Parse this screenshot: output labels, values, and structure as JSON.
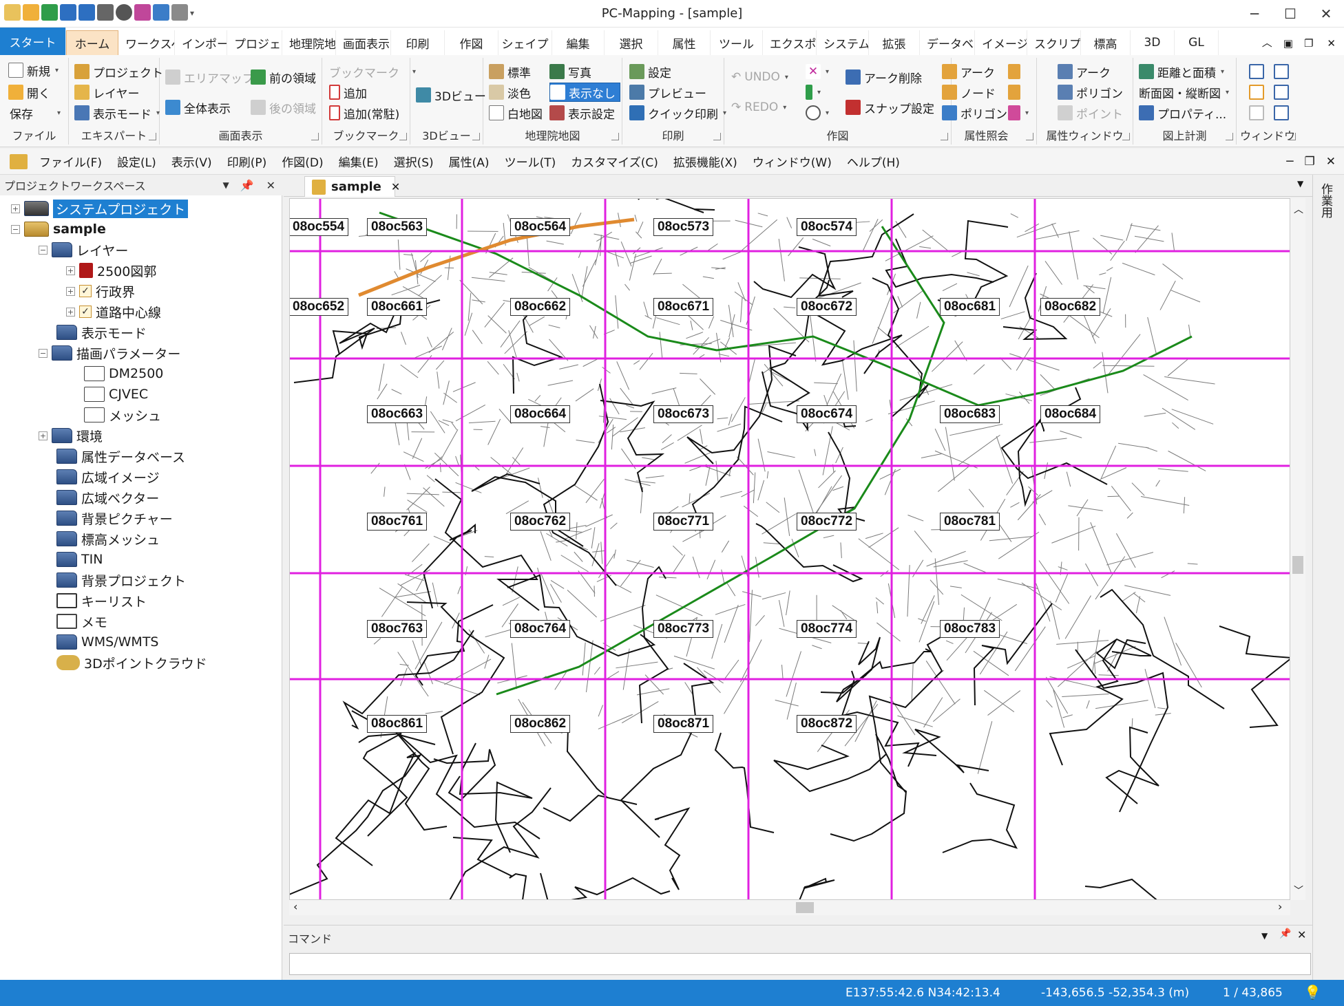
{
  "window": {
    "title": "PC-Mapping - [sample]",
    "controls": [
      "─",
      "☐",
      "✕"
    ]
  },
  "ribbon_tabs": [
    "スタート",
    "ホーム",
    "ワークスペース",
    "インポート",
    "プロジェクト",
    "地理院地",
    "画面表示",
    "印刷",
    "作図",
    "シェイプ",
    "編集",
    "選択",
    "属性",
    "ツール",
    "エクスポート",
    "システム",
    "拡張",
    "データベース",
    "イメージ",
    "スクリプト",
    "標高",
    "3D",
    "GL"
  ],
  "ribbon": {
    "file": {
      "label": "ファイル",
      "new": "新規",
      "open": "開く",
      "save": "保存"
    },
    "expert": {
      "label": "エキスパート",
      "project": "プロジェクト",
      "layer": "レイヤー",
      "display_mode": "表示モード"
    },
    "screen": {
      "label": "画面表示",
      "area_map": "エリアマップ",
      "full_display": "全体表示",
      "prev_area": "前の領域",
      "next_area": "後の領域"
    },
    "bookmark": {
      "label": "ブックマーク",
      "bookmark": "ブックマーク",
      "add": "追加",
      "add_resident": "追加(常駐)"
    },
    "view3d": {
      "label": "3Dビュー",
      "view": "3Dビュー"
    },
    "gsi": {
      "label": "地理院地図",
      "standard": "標準",
      "pale": "淡色",
      "blank": "白地図",
      "photo": "写真",
      "none": "表示なし",
      "settings": "表示設定"
    },
    "print": {
      "label": "印刷",
      "settings": "設定",
      "preview": "プレビュー",
      "quick": "クイック印刷"
    },
    "draw": {
      "label": "作図",
      "undo": "UNDO",
      "redo": "REDO",
      "arc_delete": "アーク削除",
      "snap": "スナップ設定"
    },
    "attr_query": {
      "label": "属性照会",
      "arc": "アーク",
      "node": "ノード",
      "polygon": "ポリゴン"
    },
    "attr_window": {
      "label": "属性ウィンドウ",
      "arc": "アーク",
      "polygon": "ポリゴン",
      "point": "ポイント"
    },
    "measure": {
      "label": "図上計測",
      "distance": "距離と面積",
      "section": "断面図・縦断図",
      "property": "プロパティ..."
    },
    "window": {
      "label": "ウィンドウ"
    }
  },
  "menubar": [
    "ファイル(F)",
    "設定(L)",
    "表示(V)",
    "印刷(P)",
    "作図(D)",
    "編集(E)",
    "選択(S)",
    "属性(A)",
    "ツール(T)",
    "カスタマイズ(C)",
    "拡張機能(X)",
    "ウィンドウ(W)",
    "ヘルプ(H)"
  ],
  "project_panel": {
    "title": "プロジェクトワークスペース",
    "system_project": "システムプロジェクト",
    "sample": "sample",
    "layers": "レイヤー",
    "layer_items": [
      "2500図郭",
      "行政界",
      "道路中心線"
    ],
    "display_mode": "表示モード",
    "draw_params": "描画パラメーター",
    "param_items": [
      "DM2500",
      "CJVEC",
      "メッシュ"
    ],
    "folders": [
      "環境",
      "属性データベース",
      "広域イメージ",
      "広域ベクター",
      "背景ピクチャー",
      "標高メッシュ",
      "TIN",
      "背景プロジェクト",
      "キーリスト",
      "メモ",
      "WMS/WMTS",
      "3Dポイントクラウド"
    ]
  },
  "document": {
    "tab": "sample"
  },
  "right_panel": {
    "label": "作業用"
  },
  "map": {
    "line_color": "#e020e0",
    "rows": [
      [
        "08oc554",
        "08oc563",
        "08oc564",
        "08oc573",
        "08oc574"
      ],
      [
        "08oc652",
        "08oc661",
        "08oc662",
        "08oc671",
        "08oc672",
        "08oc681",
        "08oc682"
      ],
      [
        "08oc663",
        "08oc664",
        "08oc673",
        "08oc674",
        "08oc683",
        "08oc684"
      ],
      [
        "08oc761",
        "08oc762",
        "08oc771",
        "08oc772",
        "08oc781"
      ],
      [
        "08oc763",
        "08oc764",
        "08oc773",
        "08oc774",
        "08oc783"
      ],
      [
        "08oc861",
        "08oc862",
        "08oc871",
        "08oc872"
      ]
    ]
  },
  "command": {
    "label": "コマンド",
    "value": ""
  },
  "status": {
    "geo": "E137:55:42.6 N34:42:13.4",
    "xy": "-143,656.5 -52,354.3 (m)",
    "scale": "1 / 43,865"
  }
}
